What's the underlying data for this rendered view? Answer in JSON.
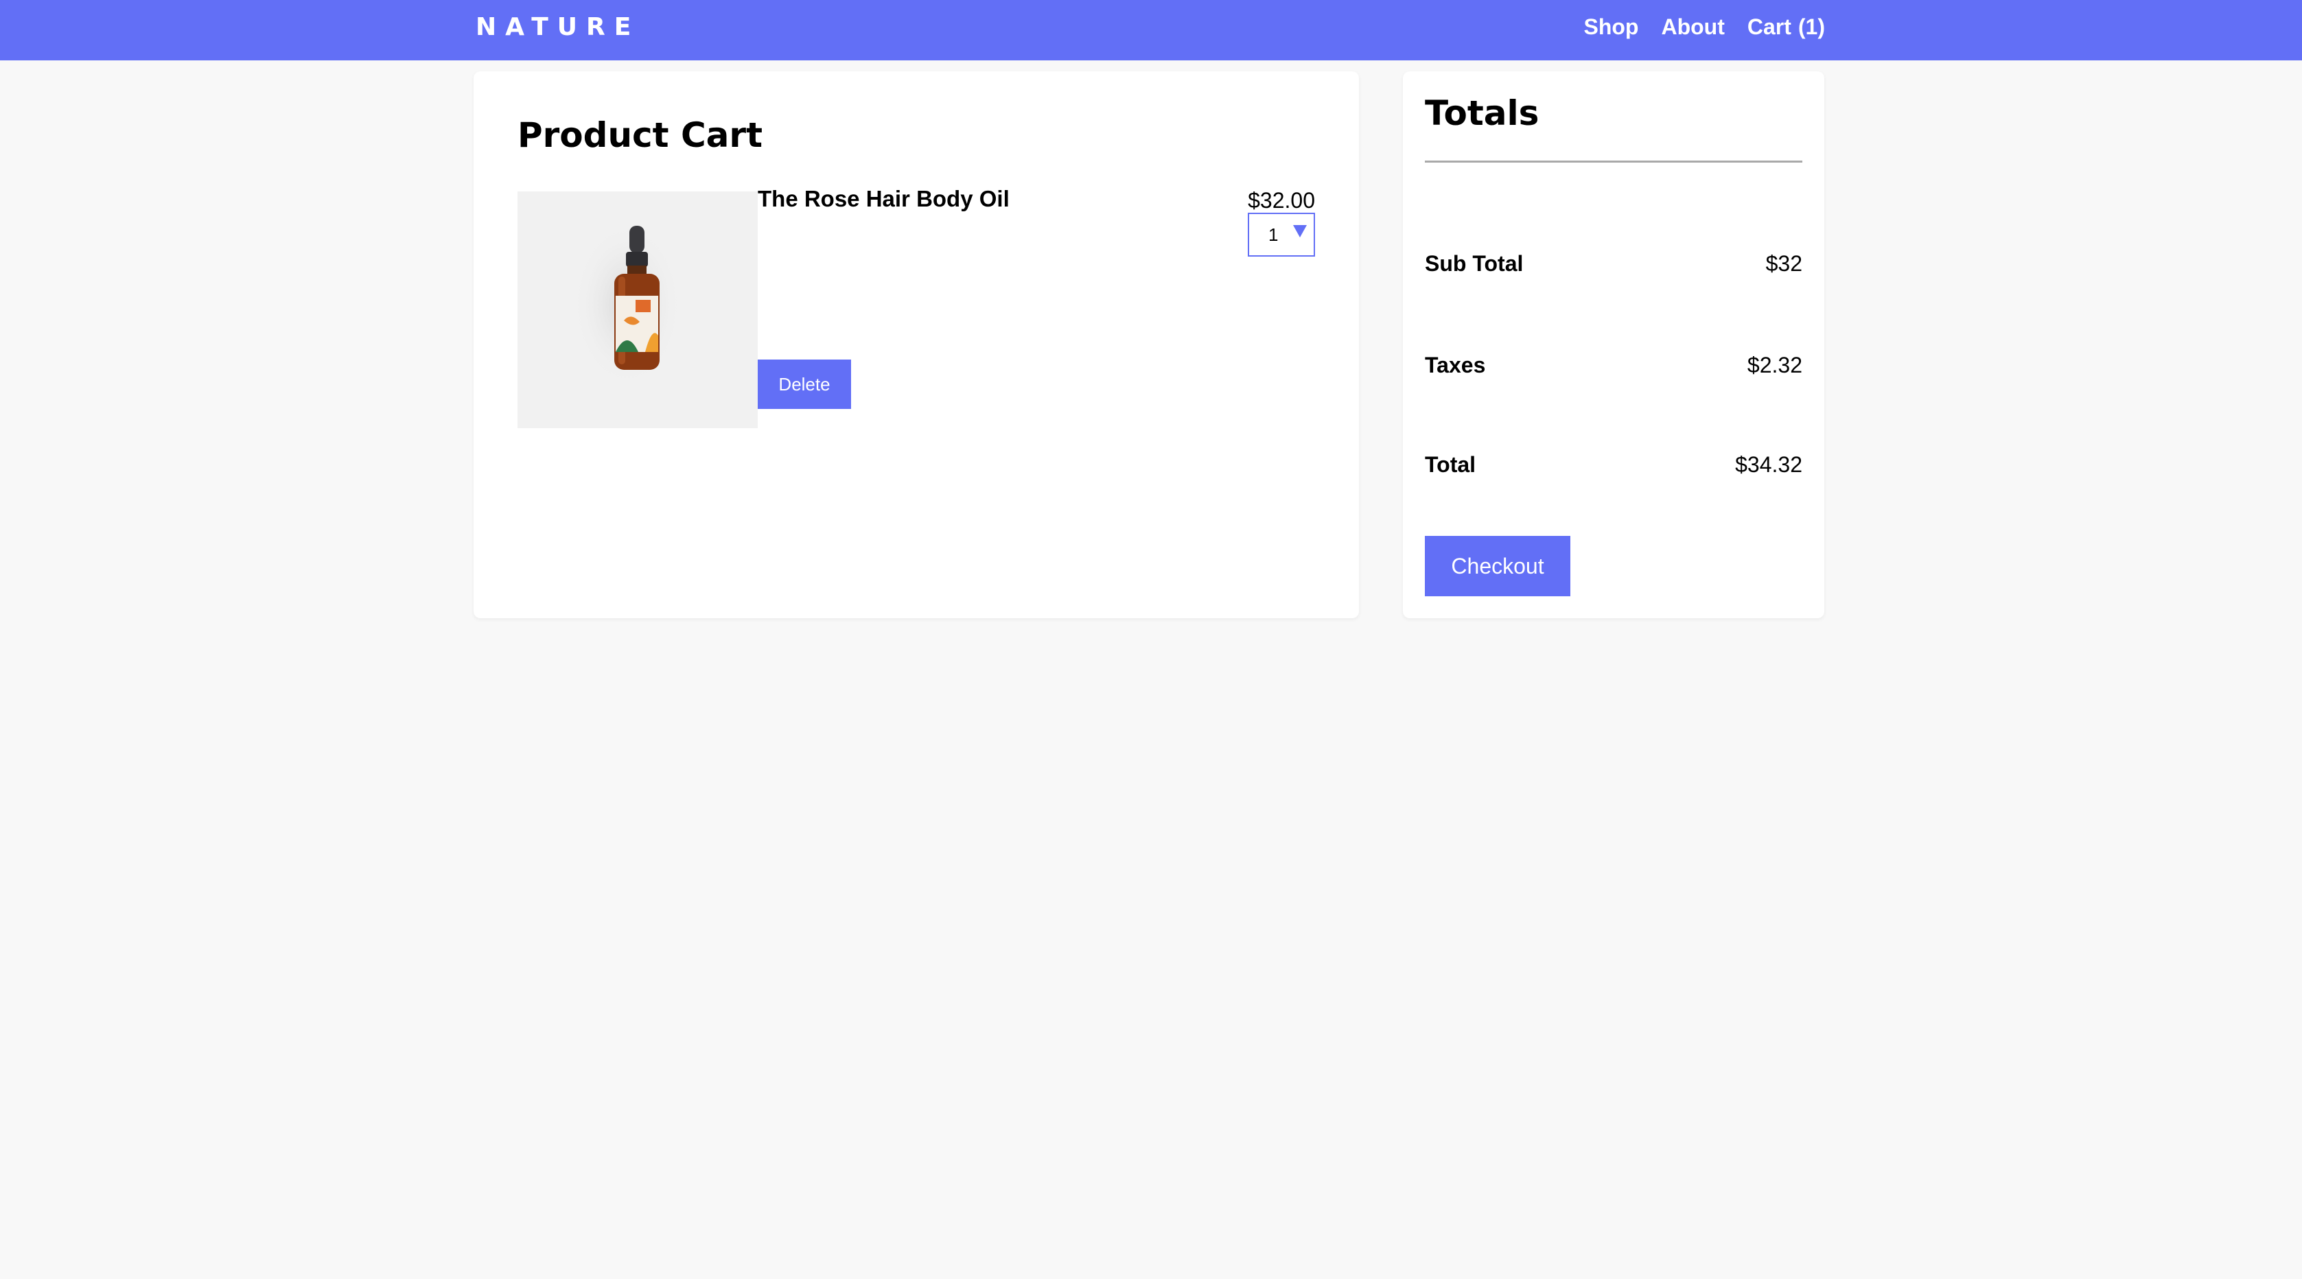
{
  "header": {
    "brand": "NATURE",
    "nav": {
      "shop": "Shop",
      "about": "About",
      "cart_label": "Cart",
      "cart_count": "(1)"
    }
  },
  "cart": {
    "title": "Product Cart",
    "items": [
      {
        "name": "The Rose Hair Body Oil",
        "price": "$32.00",
        "quantity": "1",
        "delete_label": "Delete",
        "image_icon": "serum-bottle-icon"
      }
    ]
  },
  "totals": {
    "title": "Totals",
    "subtotal_label": "Sub Total",
    "subtotal_value": "$32",
    "taxes_label": "Taxes",
    "taxes_value": "$2.32",
    "total_label": "Total",
    "total_value": "$34.32",
    "checkout_label": "Checkout"
  },
  "colors": {
    "accent": "#626ff6",
    "background": "#f8f8f8",
    "panel": "#ffffff"
  }
}
